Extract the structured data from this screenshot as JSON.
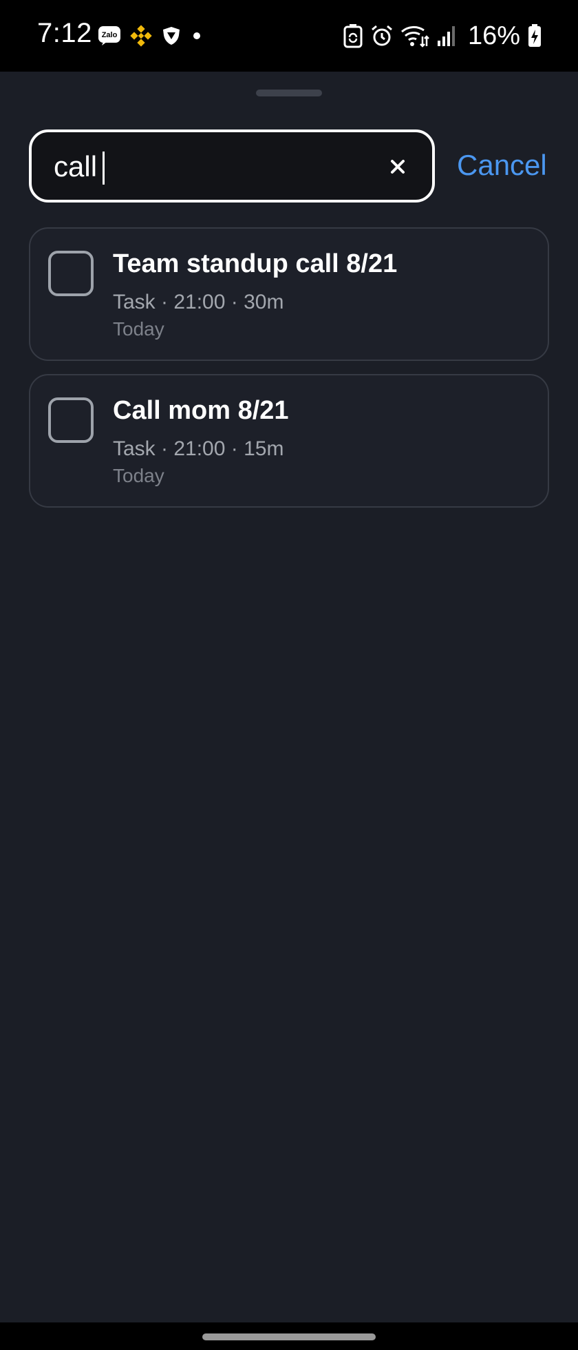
{
  "status_bar": {
    "time": "7:12",
    "battery_percent": "16%",
    "left_icons": [
      "zalo-icon",
      "binance-icon",
      "shield-icon",
      "dot-icon"
    ],
    "right_icons": [
      "battery-saver-icon",
      "alarm-icon",
      "wifi-icon",
      "signal-icon",
      "battery-icon"
    ],
    "zalo_label": "Zalo"
  },
  "search": {
    "value": "call",
    "clear_icon": "close-icon",
    "cancel_label": "Cancel"
  },
  "results": [
    {
      "title": "Team standup call 8/21",
      "meta": "Task · 21:00 · 30m",
      "date": "Today",
      "checked": false
    },
    {
      "title": "Call mom 8/21",
      "meta": "Task · 21:00 · 15m",
      "date": "Today",
      "checked": false
    }
  ],
  "colors": {
    "background": "#1b1e26",
    "accent": "#4b97f0",
    "card_border": "#363a44",
    "secondary_text": "#a3a7ae",
    "binance_yellow": "#f0b90b"
  }
}
